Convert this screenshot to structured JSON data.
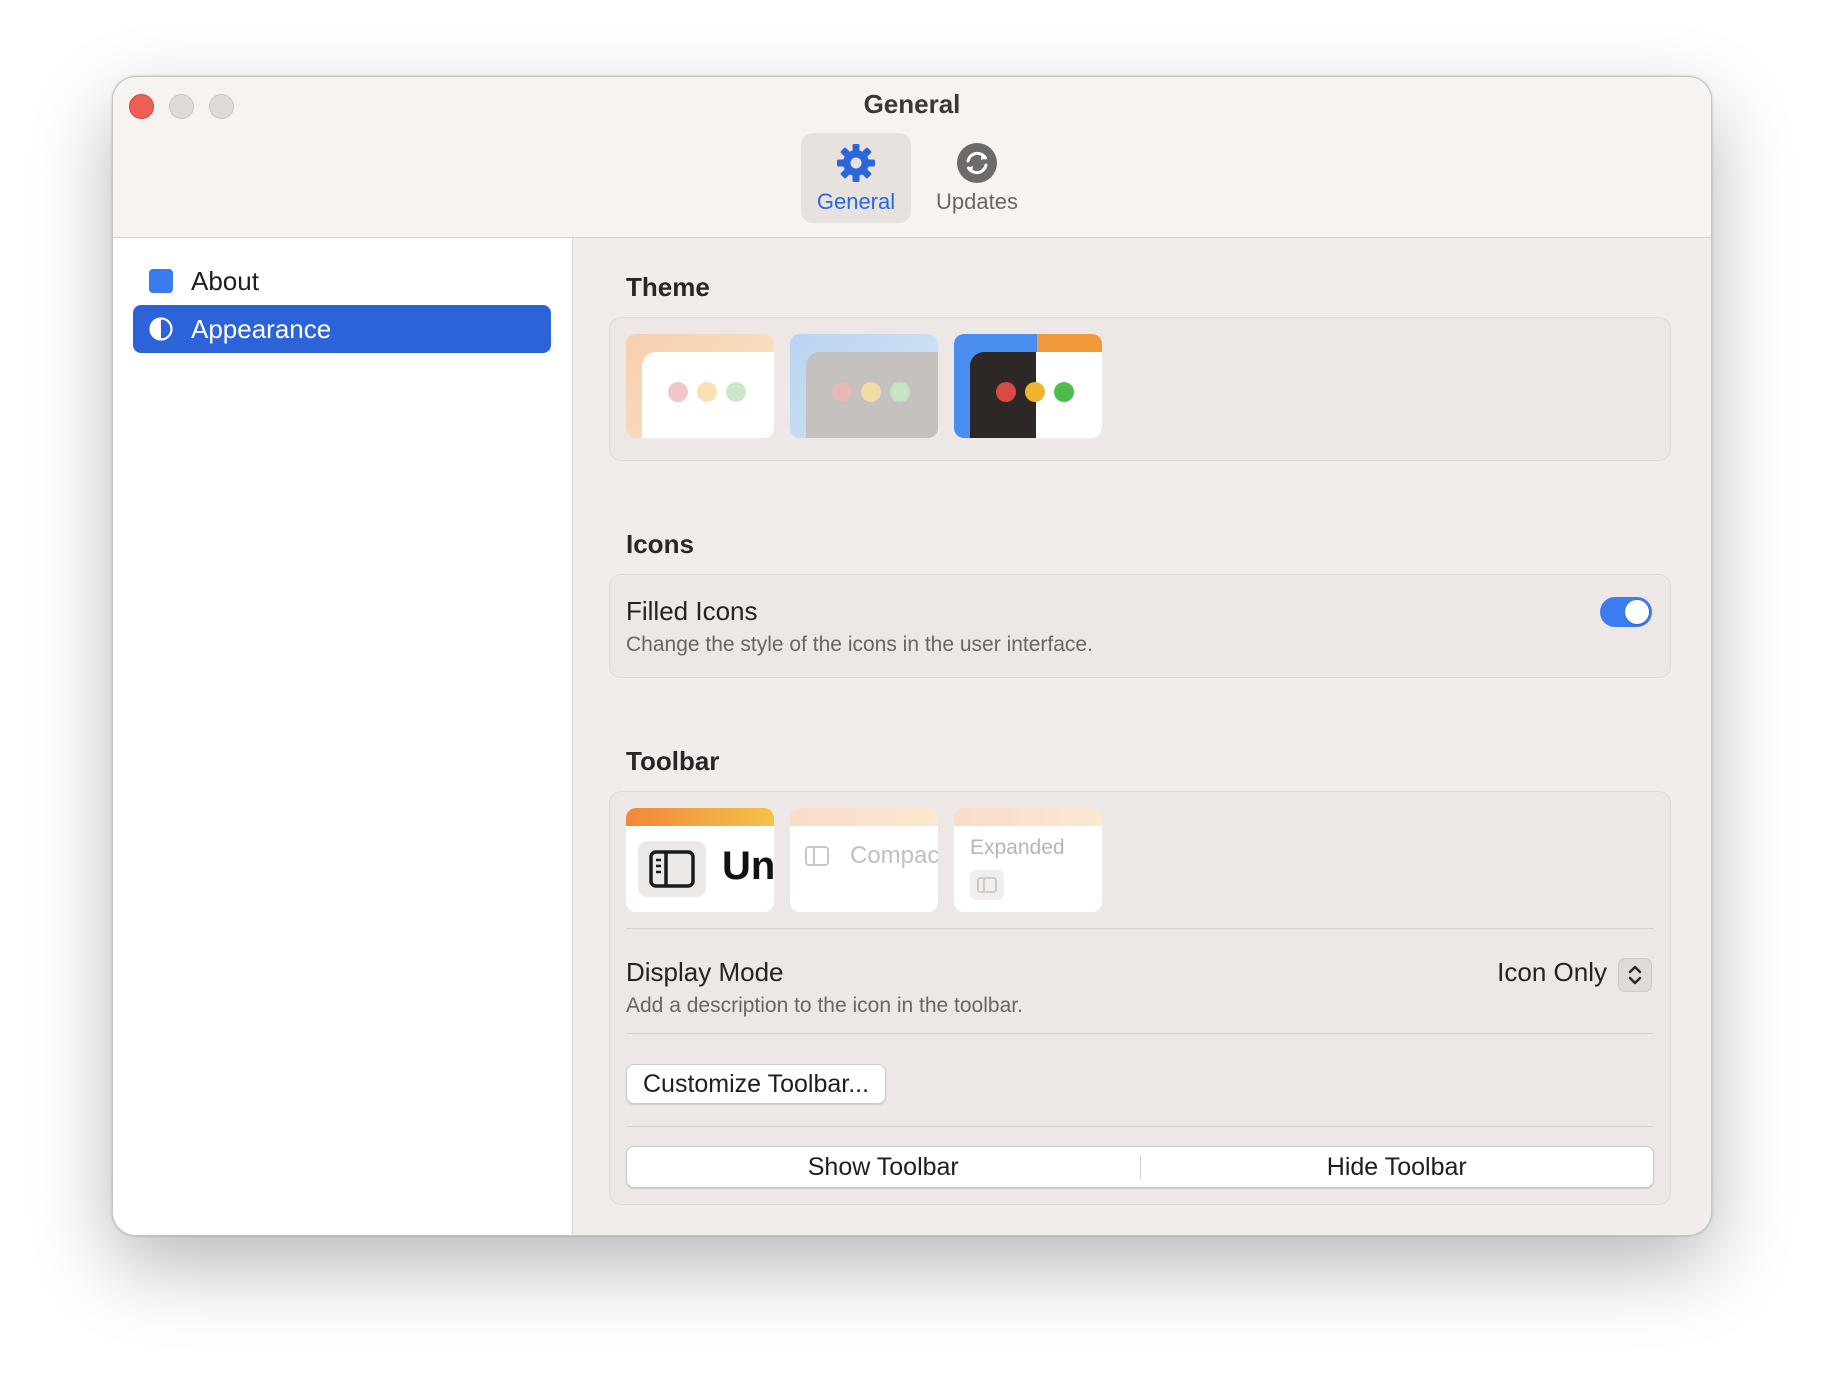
{
  "window": {
    "title": "General"
  },
  "toolbar": {
    "tabs": [
      {
        "label": "General",
        "icon": "gear-icon",
        "selected": true
      },
      {
        "label": "Updates",
        "icon": "refresh-icon",
        "selected": false
      }
    ]
  },
  "sidebar": {
    "items": [
      {
        "label": "About",
        "icon": "square-icon",
        "selected": false
      },
      {
        "label": "Appearance",
        "icon": "half-circle-icon",
        "selected": true
      }
    ]
  },
  "theme": {
    "section_title": "Theme",
    "options": [
      "light-theme",
      "gray-theme",
      "dark-theme"
    ]
  },
  "icons": {
    "section_title": "Icons",
    "filled_icons": {
      "title": "Filled Icons",
      "description": "Change the style of the icons in the user interface.",
      "enabled": true
    }
  },
  "toolbar_settings": {
    "section_title": "Toolbar",
    "styles": [
      {
        "label": "Un",
        "selected": true
      },
      {
        "label": "Compac",
        "selected": false
      },
      {
        "label": "Expanded",
        "selected": false
      }
    ],
    "display_mode": {
      "title": "Display Mode",
      "description": "Add a description to the icon in the toolbar.",
      "value": "Icon Only"
    },
    "customize_button": "Customize Toolbar...",
    "show_button": "Show Toolbar",
    "hide_button": "Hide Toolbar"
  },
  "colors": {
    "accent": "#2d63d8",
    "toggle_on": "#3b7df1",
    "close": "#ec5f57"
  }
}
